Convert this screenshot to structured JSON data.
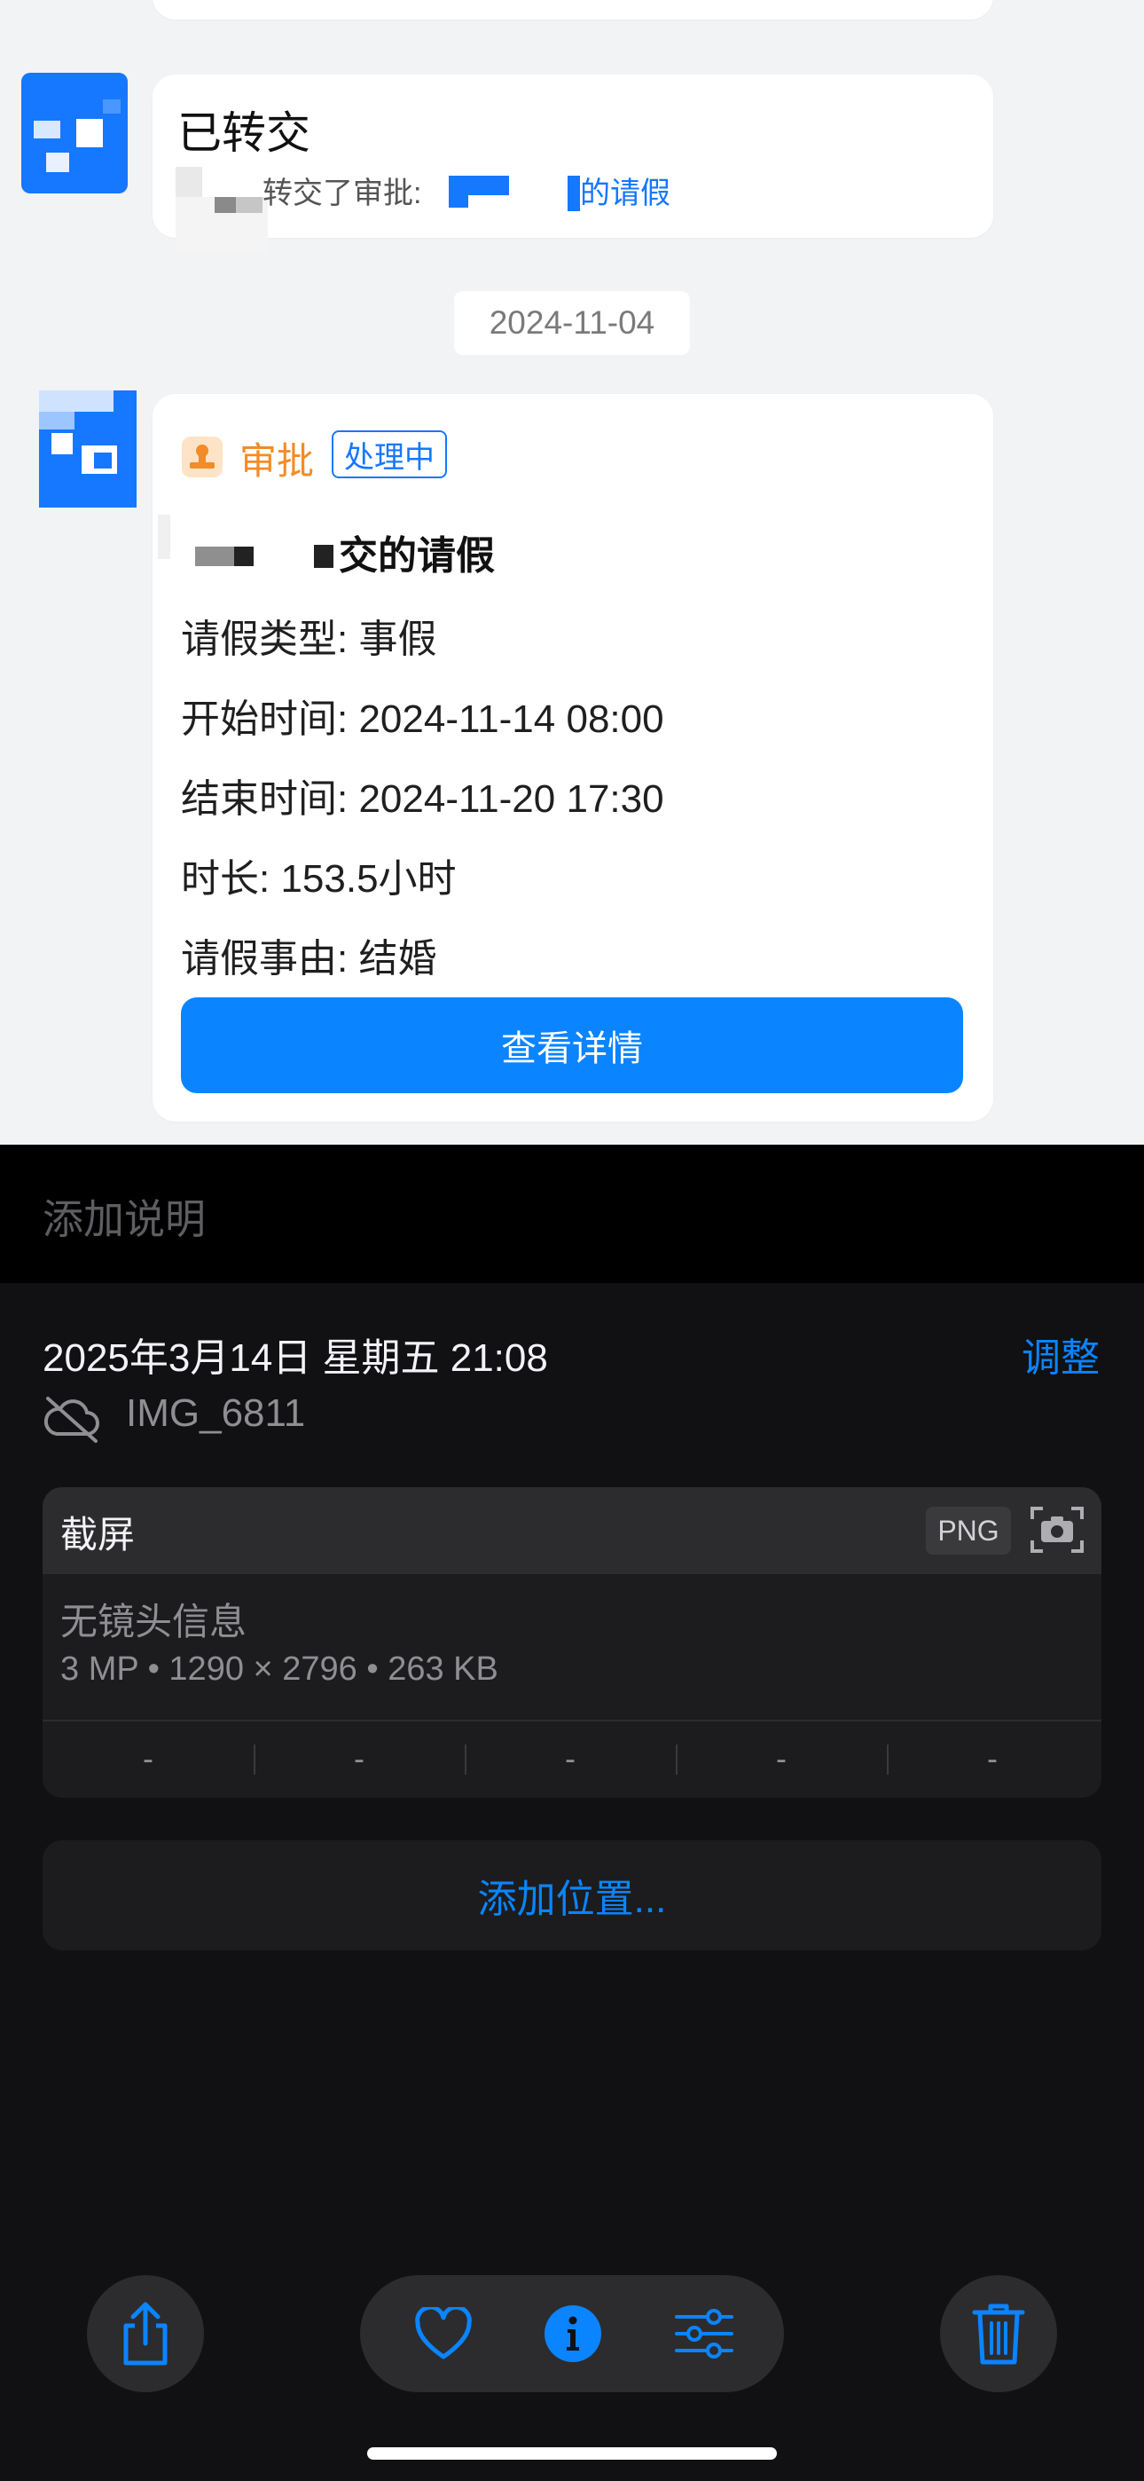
{
  "chat": {
    "transfer": {
      "title": "已转交",
      "text_prefix": "转交了审批:",
      "text_suffix": "的请假"
    },
    "date_divider": "2024-11-04",
    "approval": {
      "tag": "审批",
      "status": "处理中",
      "heading_suffix": "交的请假",
      "lines": [
        "请假类型: 事假",
        "开始时间: 2024-11-14 08:00",
        "结束时间: 2024-11-20 17:30",
        "时长: 153.5小时",
        "请假事由: 结婚"
      ],
      "detail_button": "查看详情"
    }
  },
  "caption_placeholder": "添加说明",
  "info": {
    "datetime": "2025年3月14日 星期五 21:08",
    "adjust_label": "调整",
    "cloud_icon": "cloud-off-icon",
    "filename": "IMG_6811",
    "kind": "截屏",
    "format": "PNG",
    "lens": "无镜头信息",
    "specs": "3 MP • 1290 × 2796 • 263 KB",
    "exif": [
      "-",
      "-",
      "-",
      "-",
      "-"
    ],
    "add_location": "添加位置..."
  },
  "toolbar": {
    "share_icon": "share-icon",
    "favorite_icon": "heart-icon",
    "info_icon": "info-icon",
    "edit_icon": "sliders-icon",
    "delete_icon": "trash-icon"
  },
  "colors": {
    "accent": "#0a84ff",
    "approval_tag": "#f28c28",
    "panel_bg": "#111113"
  }
}
